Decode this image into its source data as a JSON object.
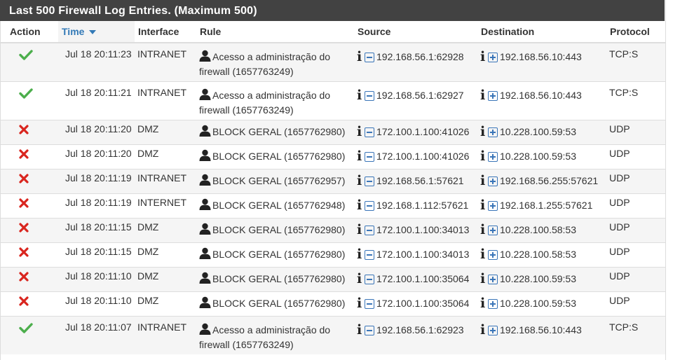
{
  "panel": {
    "title": "Last 500 Firewall Log Entries. (Maximum 500)"
  },
  "columns": {
    "action": "Action",
    "time": "Time",
    "interface": "Interface",
    "rule": "Rule",
    "source": "Source",
    "destination": "Destination",
    "protocol": "Protocol"
  },
  "sort": {
    "column": "time",
    "direction": "descending"
  },
  "colors": {
    "pass": "#4cae4c",
    "block": "#d9251e",
    "header_bg": "#424242",
    "icon_blue": "#3a75b8"
  },
  "rows": [
    {
      "action": "pass",
      "time": "Jul 18 20:11:23",
      "interface": "INTRANET",
      "rule_line1": "Acesso a administração do",
      "rule_line2": "firewall (1657763249)",
      "source": "192.168.56.1:62928",
      "destination": "192.168.56.10:443",
      "protocol": "TCP:S"
    },
    {
      "action": "pass",
      "time": "Jul 18 20:11:21",
      "interface": "INTRANET",
      "rule_line1": "Acesso a administração do",
      "rule_line2": "firewall (1657763249)",
      "source": "192.168.56.1:62927",
      "destination": "192.168.56.10:443",
      "protocol": "TCP:S"
    },
    {
      "action": "block",
      "time": "Jul 18 20:11:20",
      "interface": "DMZ",
      "rule_line1": "BLOCK GERAL (1657762980)",
      "rule_line2": "",
      "source": "172.100.1.100:41026",
      "destination": "10.228.100.59:53",
      "protocol": "UDP"
    },
    {
      "action": "block",
      "time": "Jul 18 20:11:20",
      "interface": "DMZ",
      "rule_line1": "BLOCK GERAL (1657762980)",
      "rule_line2": "",
      "source": "172.100.1.100:41026",
      "destination": "10.228.100.59:53",
      "protocol": "UDP"
    },
    {
      "action": "block",
      "time": "Jul 18 20:11:19",
      "interface": "INTRANET",
      "rule_line1": "BLOCK GERAL (1657762957)",
      "rule_line2": "",
      "source": "192.168.56.1:57621",
      "destination": "192.168.56.255:57621",
      "protocol": "UDP"
    },
    {
      "action": "block",
      "time": "Jul 18 20:11:19",
      "interface": "INTERNET",
      "rule_line1": "BLOCK GERAL (1657762948)",
      "rule_line2": "",
      "source": "192.168.1.112:57621",
      "destination": "192.168.1.255:57621",
      "protocol": "UDP"
    },
    {
      "action": "block",
      "time": "Jul 18 20:11:15",
      "interface": "DMZ",
      "rule_line1": "BLOCK GERAL (1657762980)",
      "rule_line2": "",
      "source": "172.100.1.100:34013",
      "destination": "10.228.100.58:53",
      "protocol": "UDP"
    },
    {
      "action": "block",
      "time": "Jul 18 20:11:15",
      "interface": "DMZ",
      "rule_line1": "BLOCK GERAL (1657762980)",
      "rule_line2": "",
      "source": "172.100.1.100:34013",
      "destination": "10.228.100.58:53",
      "protocol": "UDP"
    },
    {
      "action": "block",
      "time": "Jul 18 20:11:10",
      "interface": "DMZ",
      "rule_line1": "BLOCK GERAL (1657762980)",
      "rule_line2": "",
      "source": "172.100.1.100:35064",
      "destination": "10.228.100.59:53",
      "protocol": "UDP"
    },
    {
      "action": "block",
      "time": "Jul 18 20:11:10",
      "interface": "DMZ",
      "rule_line1": "BLOCK GERAL (1657762980)",
      "rule_line2": "",
      "source": "172.100.1.100:35064",
      "destination": "10.228.100.59:53",
      "protocol": "UDP"
    },
    {
      "action": "pass",
      "time": "Jul 18 20:11:07",
      "interface": "INTRANET",
      "rule_line1": "Acesso a administração do",
      "rule_line2": "firewall (1657763249)",
      "source": "192.168.56.1:62923",
      "destination": "192.168.56.10:443",
      "protocol": "TCP:S"
    }
  ]
}
